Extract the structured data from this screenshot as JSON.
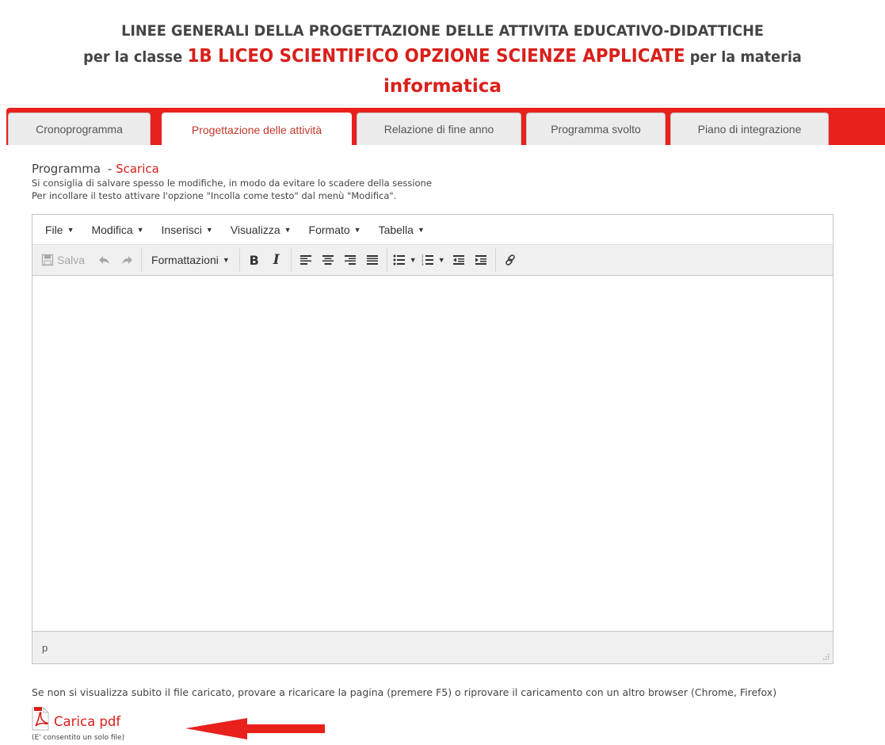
{
  "header": {
    "line1": "LINEE GENERALI DELLA PROGETTAZIONE DELLE ATTIVITA EDUCATIVO-DIDATTICHE",
    "line2_prefix": "per la classe",
    "class_name": "1B LICEO SCIENTIFICO OPZIONE SCIENZE APPLICATE",
    "line2_suffix": "per la materia",
    "subject": "informatica"
  },
  "tabs": [
    {
      "label": "Cronoprogramma",
      "active": false
    },
    {
      "label": "Progettazione delle attività",
      "active": true
    },
    {
      "label": "Relazione di fine anno",
      "active": false
    },
    {
      "label": "Programma svolto",
      "active": false
    },
    {
      "label": "Piano di integrazione",
      "active": false
    }
  ],
  "program": {
    "title": "Programma",
    "separator": "-",
    "download_link": "Scarica",
    "hint1": "Si consiglia di salvare spesso le modifiche, in modo da evitare lo scadere della sessione",
    "hint2": "Per incollare il testo attivare l'opzione \"Incolla come testo\" dal menù \"Modifica\"."
  },
  "editor": {
    "menus": [
      "File",
      "Modifica",
      "Inserisci",
      "Visualizza",
      "Formato",
      "Tabella"
    ],
    "save_label": "Salva",
    "formats_label": "Formattazioni",
    "bold_label": "B",
    "italic_label": "I",
    "status_path": "p"
  },
  "footer": {
    "note": "Se non si visualizza subito il file caricato, provare a ricaricare la pagina (premere F5) o riprovare il caricamento con un altro browser (Chrome, Firefox)",
    "upload_label": "Carica pdf",
    "upload_subnote": "(E' consentito un solo file)"
  },
  "colors": {
    "accent": "#d9201b",
    "tabbar": "#e8211d",
    "toolbar_bg": "#f0f0f0"
  }
}
